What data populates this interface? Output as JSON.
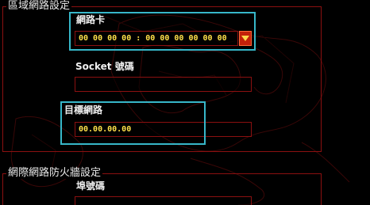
{
  "lan_settings": {
    "title": "區域網路設定",
    "network_card": {
      "label": "網路卡",
      "value": "00 00 00 00 : 00 00 00 00 00 00"
    },
    "socket": {
      "label": "Socket 號碼",
      "value": ""
    },
    "target_network": {
      "label": "目標網路",
      "value": "00.00.00.00"
    }
  },
  "firewall_settings": {
    "title": "網際網路防火牆設定",
    "port": {
      "label": "埠號碼"
    }
  },
  "colors": {
    "background": "#000000",
    "border_red": "#8c1010",
    "value_yellow": "#ffe14a",
    "highlight_cyan": "#37b7c9",
    "dropdown_red": "#c4200a"
  },
  "icons": {
    "dropdown": "triangle-down-icon"
  }
}
